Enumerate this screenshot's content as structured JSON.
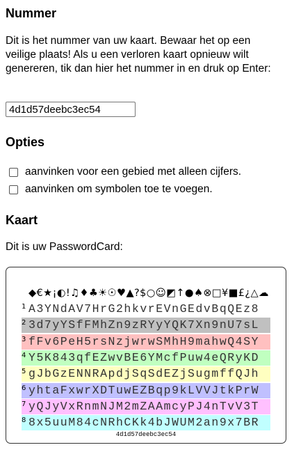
{
  "number_section": {
    "heading": "Nummer",
    "intro": "Dit is het nummer van uw kaart. Bewaar het op een veilige plaats! Als u een verloren kaart opnieuw wilt genereren, tik dan hier het nummer in en druk op Enter:",
    "input_value": "4d1d57deebc3ec54"
  },
  "options_section": {
    "heading": "Opties",
    "options": [
      {
        "label": "aanvinken voor een gebied met alleen cijfers.",
        "checked": false
      },
      {
        "label": "aanvinken om symbolen toe te voegen.",
        "checked": false
      }
    ]
  },
  "card_section": {
    "heading": "Kaart",
    "caption": "Dit is uw PasswordCard:",
    "symbols": "◆€★¡◐!♫♦♣☀☉♥▲?$○☺◩↑●♠⊗□¥■£¿△☁",
    "rows": [
      {
        "num": "1",
        "chars": "A3YNdAV7HrG2hkvrEVnGEdvBqQEz8",
        "color": "#ffffff"
      },
      {
        "num": "2",
        "chars": "3d7yYSfFMhZn9zRYyYQK7Xn9nU7sL",
        "color": "#c0c0c0"
      },
      {
        "num": "3",
        "chars": "fFv6PeH5rsNzjwrwSMhH9mahwQ4SY",
        "color": "#ffc0c0"
      },
      {
        "num": "4",
        "chars": "Y5K843qfEZwvBE6YMcfPuw4eQRyKD",
        "color": "#c0ffc0"
      },
      {
        "num": "5",
        "chars": "gJbGzENNRApdjSqSdEZjSugmffQJh",
        "color": "#ffffc0"
      },
      {
        "num": "6",
        "chars": "yhtaFxwrXDTuwEZBqp9kLVVJtkPrW",
        "color": "#c0c0ff"
      },
      {
        "num": "7",
        "chars": "yQJyVxRnmNJM2mZAAmcyPJ4nTvV3T",
        "color": "#ffc0ff"
      },
      {
        "num": "8",
        "chars": "8x5uuM84cNRhCKk4bJWUM2an9x7BR",
        "color": "#c0ffff"
      }
    ],
    "footer_number": "4d1d57deebc3ec54"
  }
}
